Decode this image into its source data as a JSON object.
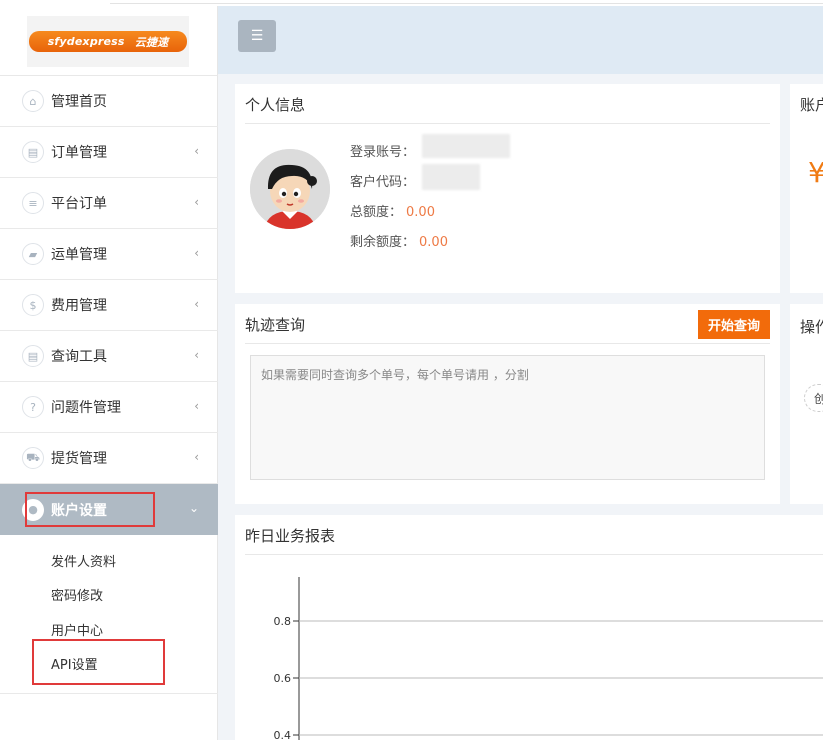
{
  "logo": {
    "text_left": "sfydexpress",
    "text_right": "云捷速"
  },
  "sidebar": {
    "items": [
      {
        "label": "管理首页",
        "icon": "home-icon",
        "has_chevron": false
      },
      {
        "label": "订单管理",
        "icon": "document-icon",
        "has_chevron": true
      },
      {
        "label": "平台订单",
        "icon": "list-icon",
        "has_chevron": true
      },
      {
        "label": "运单管理",
        "icon": "truck-icon",
        "has_chevron": true
      },
      {
        "label": "费用管理",
        "icon": "dollar-icon",
        "has_chevron": true
      },
      {
        "label": "查询工具",
        "icon": "document-icon",
        "has_chevron": true
      },
      {
        "label": "问题件管理",
        "icon": "question-icon",
        "has_chevron": true
      },
      {
        "label": "提货管理",
        "icon": "cart-icon",
        "has_chevron": true
      }
    ],
    "active": {
      "label": "账户设置",
      "icon": "user-icon"
    },
    "submenu": [
      "发件人资料",
      "密码修改",
      "用户中心",
      "API设置"
    ]
  },
  "info_card": {
    "title": "个人信息",
    "login_label": "登录账号：",
    "customer_label": "客户代码：",
    "total_label": "总额度：",
    "total_value": "0.00",
    "remaining_label": "剩余额度：",
    "remaining_value": "0.00"
  },
  "account_card": {
    "title": "账户",
    "currency": "¥"
  },
  "track_card": {
    "title": "轨迹查询",
    "button": "开始查询",
    "placeholder": "如果需要同时查询多个单号，每个单号请用 ，分割"
  },
  "ops_card": {
    "title": "操作",
    "pill": "创"
  },
  "report_card": {
    "title": "昨日业务报表"
  },
  "colors": {
    "accent": "#f26b0b",
    "active_menu": "#afbac4",
    "value": "#ee7a45",
    "highlight_box": "#e03a3a"
  },
  "chart_data": {
    "type": "line",
    "title": "",
    "y_ticks": [
      "0.8",
      "0.6",
      "0.4"
    ],
    "y_tick_values": [
      0.8,
      0.6,
      0.4
    ],
    "ylim_visible": [
      0.4,
      0.85
    ],
    "series": [],
    "grid": true
  }
}
